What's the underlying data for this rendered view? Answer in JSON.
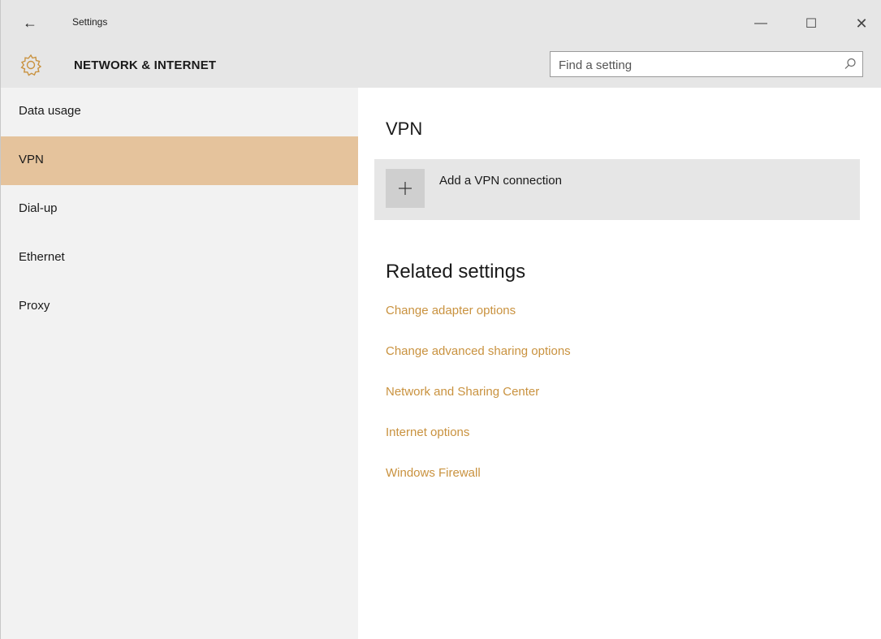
{
  "window": {
    "title": "Settings",
    "controls": {
      "minimize": "—",
      "maximize": "☐",
      "close": "✕"
    },
    "back_glyph": "←"
  },
  "header": {
    "section_title": "NETWORK & INTERNET",
    "search": {
      "placeholder": "Find a setting",
      "value": ""
    }
  },
  "sidebar": {
    "items": [
      {
        "label": "Data usage",
        "selected": false
      },
      {
        "label": "VPN",
        "selected": true
      },
      {
        "label": "Dial-up",
        "selected": false
      },
      {
        "label": "Ethernet",
        "selected": false
      },
      {
        "label": "Proxy",
        "selected": false
      }
    ]
  },
  "main": {
    "title": "VPN",
    "add_connection_label": "Add a VPN connection",
    "related": {
      "title": "Related settings",
      "links": [
        "Change adapter options",
        "Change advanced sharing options",
        "Network and Sharing Center",
        "Internet options",
        "Windows Firewall"
      ]
    }
  },
  "colors": {
    "accent": "#e5c39c",
    "link": "#c9923f",
    "titlebar_bg": "#e6e6e6",
    "sidebar_bg": "#f2f2f2"
  },
  "icons": {
    "back": "back-arrow-icon",
    "gear": "gear-icon",
    "search": "search-icon",
    "plus": "plus-icon"
  }
}
